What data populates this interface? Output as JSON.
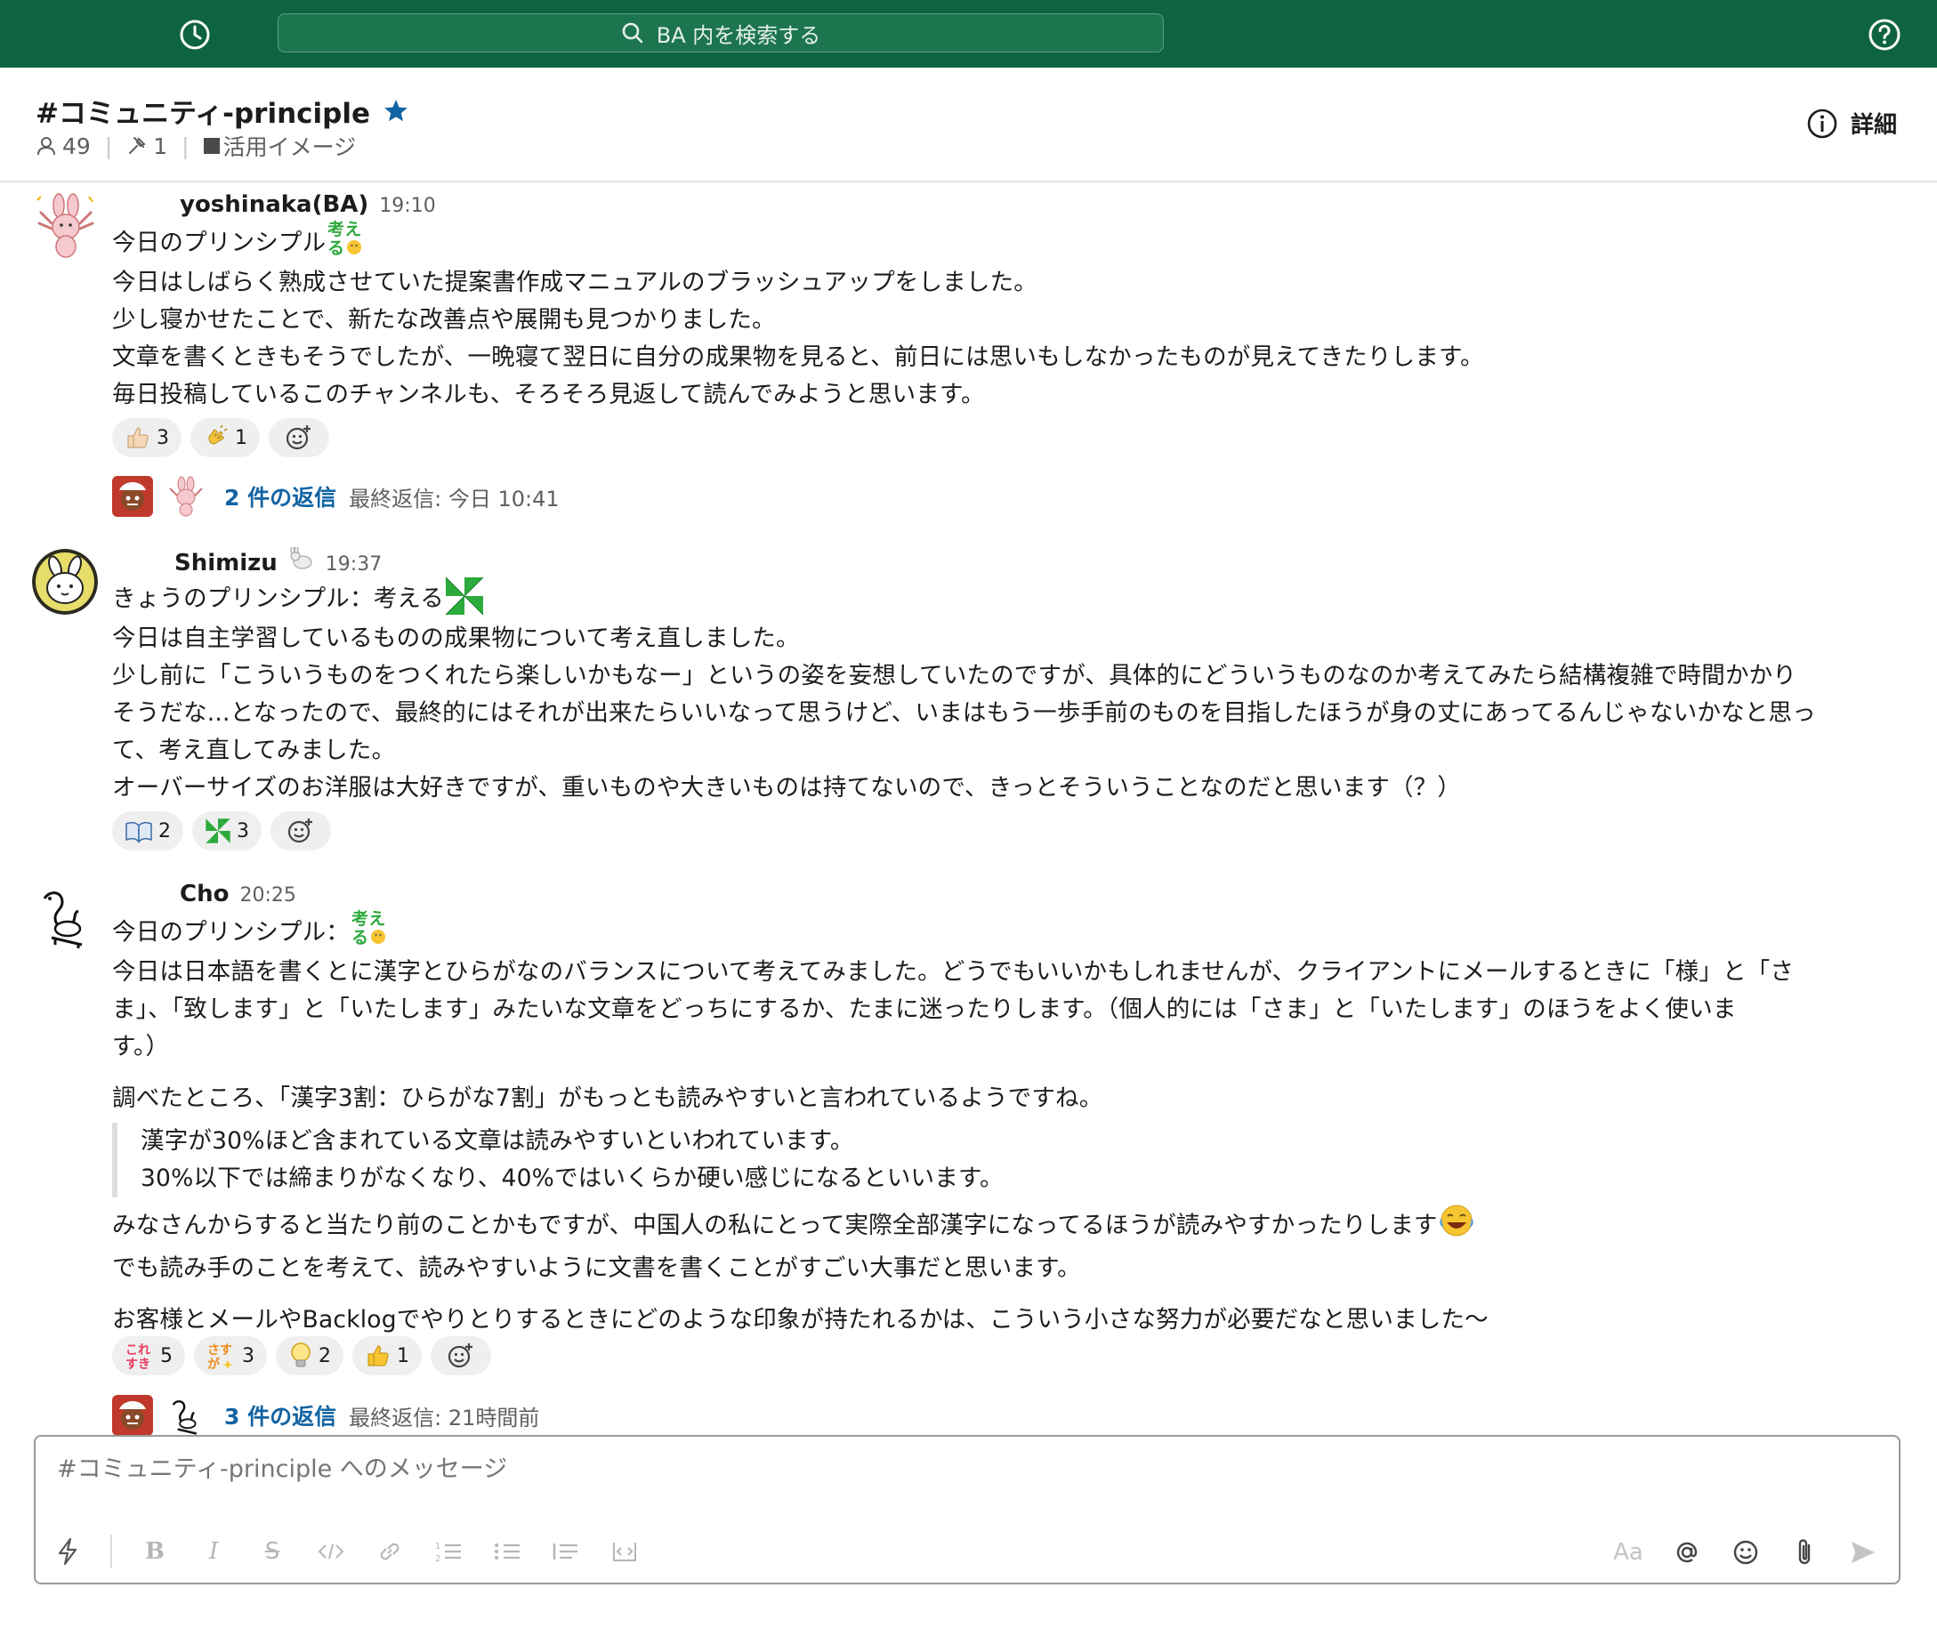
{
  "topbar": {
    "search_placeholder": "BA 内を検索する",
    "bg_color": "#0e6440"
  },
  "channel": {
    "name": "#コミュニティ-principle",
    "members": "49",
    "pins": "1",
    "topic": "活用イメージ",
    "details_label": "詳細",
    "star_color": "#1264a3"
  },
  "messages": [
    {
      "author": "yoshinaka(BA)",
      "time": "19:10",
      "lines": [
        "今日のプリンシプル",
        "今日はしばらく熟成させていた提案書作成マニュアルのブラッシュアップをしました。",
        "少し寝かせたことで、新たな改善点や展開も見つかりました。",
        "文章を書くときもそうでしたが、一晩寝て翌日に自分の成果物を見ると、前日には思いもしなかったものが見えてきたりします。",
        "毎日投稿しているこのチャンネルも、そろそろ見返して読んでみようと思います。"
      ],
      "reactions": [
        {
          "icon": "thumbs-up-light",
          "count": "3"
        },
        {
          "icon": "clap",
          "count": "1"
        }
      ],
      "thread": {
        "replies": "2 件の返信",
        "last": "最終返信: 今日 10:41"
      }
    },
    {
      "author": "Shimizu",
      "time": "19:37",
      "lines": [
        "きょうのプリンシプル：考える",
        "今日は自主学習しているものの成果物について考え直しました。",
        "少し前に「こういうものをつくれたら楽しいかもなー」というの姿を妄想していたのですが、具体的にどういうものなのか考えてみたら結構複雑で時間かかり",
        "そうだな...となったので、最終的にはそれが出来たらいいなって思うけど、いまはもう一歩手前のものを目指したほうが身の丈にあってるんじゃないかなと思っ",
        "て、考え直してみました。",
        "オーバーサイズのお洋服は大好きですが、重いものや大きいものは持てないので、きっとそういうことなのだと思います（？）"
      ],
      "reactions": [
        {
          "icon": "open-book",
          "count": "2"
        },
        {
          "icon": "pinwheel",
          "count": "3"
        }
      ]
    },
    {
      "author": "Cho",
      "time": "20:25",
      "lines": [
        "今日のプリンシプル：",
        "今日は日本語を書くとに漢字とひらがなのバランスについて考えてみました。どうでもいいかもしれませんが、クライアントにメールするときに「様」と「さ",
        "ま」、「致します」と「いたします」みたいな文章をどっちにするか、たまに迷ったりします。（個人的には「さま」と「いたします」のほうをよく使いま",
        "す。）"
      ],
      "para2": "調べたところ、「漢字3割：ひらがな7割」がもっとも読みやすいと言われているようですね。",
      "quote": [
        "漢字が30%ほど含まれている文章は読みやすいといわれています。",
        "30%以下では締まりがなくなり、40%ではいくらか硬い感じになるといいます。"
      ],
      "para3": [
        "みなさんからすると当たり前のことかもですが、中国人の私にとって実際全部漢字になってるほうが読みやすかったりします",
        "でも読み手のことを考えて、読みやすいように文書を書くことがすごい大事だと思います。"
      ],
      "para4": "お客様とメールやBacklogでやりとりするときにどのような印象が持たれるかは、こういう小さな努力が必要だなと思いました〜",
      "reactions": [
        {
          "icon": "koresuki",
          "count": "5"
        },
        {
          "icon": "sasuga",
          "count": "3"
        },
        {
          "icon": "bulb",
          "count": "2"
        },
        {
          "icon": "thumbs-up",
          "count": "1"
        }
      ],
      "thread": {
        "replies": "3 件の返信",
        "last": "最終返信: 21時間前"
      }
    }
  ],
  "emoji_text": {
    "kangaeru_top": "考え",
    "kangaeru_bottom": "る",
    "koresuki_top": "これ",
    "koresuki_bottom": "すき",
    "sasuga_top": "さす",
    "sasuga_bottom": "が"
  },
  "composer": {
    "placeholder": "#コミュニティ-principle へのメッセージ",
    "format_label": "Aa"
  }
}
